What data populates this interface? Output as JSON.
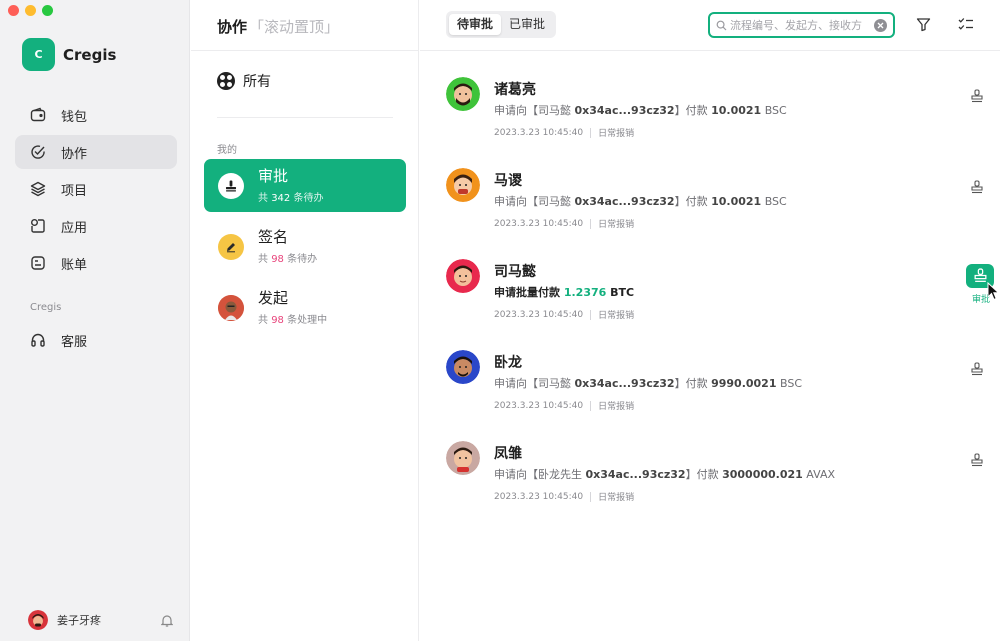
{
  "colors": {
    "accent": "#13b07e",
    "highlight_num": "#e8457c"
  },
  "app": {
    "name": "Cregis",
    "logo_letter": "C"
  },
  "sidebar": {
    "items": [
      {
        "label": "钱包",
        "icon": "wallet-icon"
      },
      {
        "label": "协作",
        "icon": "check-circle-icon",
        "active": true
      },
      {
        "label": "项目",
        "icon": "layers-icon"
      },
      {
        "label": "应用",
        "icon": "apps-icon"
      },
      {
        "label": "账单",
        "icon": "bill-icon"
      }
    ],
    "section_label": "Cregis",
    "support": {
      "label": "客服",
      "icon": "headset-icon"
    },
    "user": {
      "name": "姜子牙疼"
    }
  },
  "middle": {
    "title": "协作",
    "subtitle": "「滚动置顶」",
    "all_label": "所有",
    "mine_label": "我的",
    "categories": [
      {
        "title": "审批",
        "prefix": "共 ",
        "count": "342",
        "suffix": " 条待办",
        "active": true
      },
      {
        "title": "签名",
        "prefix": "共 ",
        "count": "98",
        "suffix": " 条待办"
      },
      {
        "title": "发起",
        "prefix": "共 ",
        "count": "98",
        "suffix": " 条处理中"
      }
    ]
  },
  "topbar": {
    "tabs": [
      {
        "label": "待审批",
        "active": true
      },
      {
        "label": "已审批"
      }
    ],
    "search_placeholder": "流程编号、发起方、接收方"
  },
  "list": [
    {
      "name": "诸葛亮",
      "desc_pre": "申请向【司马懿 ",
      "addr": "0x34ac...93cz32",
      "desc_mid": "】付款 ",
      "amount": "10.0021",
      "chain": "BSC",
      "date": "2023.3.23  10:45:40",
      "tag": "日常报销"
    },
    {
      "name": "马谡",
      "desc_pre": "申请向【司马懿 ",
      "addr": "0x34ac...93cz32",
      "desc_mid": "】付款 ",
      "amount": "10.0021",
      "chain": "BSC",
      "date": "2023.3.23  10:45:40",
      "tag": "日常报销"
    },
    {
      "name": "司马懿",
      "batch_label": "申请批量付款",
      "amount": "1.2376",
      "chain": "BTC",
      "date": "2023.3.23  10:45:40",
      "tag": "日常报销",
      "action_label": "审批"
    },
    {
      "name": "卧龙",
      "desc_pre": "申请向【司马懿 ",
      "addr": "0x34ac...93cz32",
      "desc_mid": "】付款 ",
      "amount": "9990.0021",
      "chain": "BSC",
      "date": "2023.3.23  10:45:40",
      "tag": "日常报销"
    },
    {
      "name": "凤雏",
      "desc_pre": "申请向【卧龙先生 ",
      "addr": "0x34ac...93cz32",
      "desc_mid": "】付款 ",
      "amount": "3000000.021",
      "chain": "AVAX",
      "date": "2023.3.23  10:45:40",
      "tag": "日常报销"
    }
  ]
}
